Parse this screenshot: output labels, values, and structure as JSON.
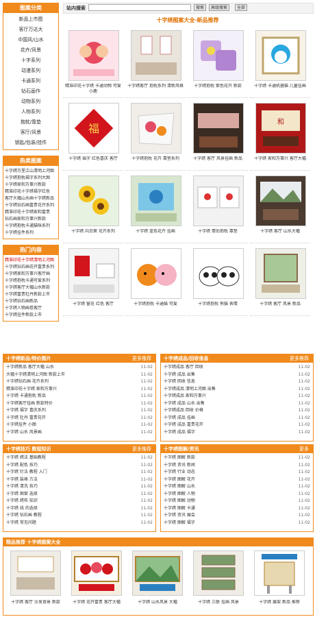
{
  "search": {
    "label": "站内搜索",
    "placeholder": "",
    "btn_search": "搜索",
    "btn_adv": "高级搜索",
    "btn_reset": "全部"
  },
  "sidebar": {
    "categories_title": "图案分类",
    "categories": [
      "新品上市图",
      "客厅万达大",
      "中国风/山水",
      "花卉/风景",
      "十字系列",
      "动漫系列",
      "卡通系列",
      "钻石画作",
      "动物系列",
      "人物系列",
      "抱枕/靠垫",
      "客厅/风景",
      "钥匙/包装/挂件"
    ],
    "hot_title": "热卖图案",
    "hot": [
      "十字绣万里江山清明上河图",
      "十字绣抱枕福字系列大图",
      "十字绣家和万事兴新款",
      "精准印花十字绣福字红色",
      "客厅大幅山水画十字绣新品",
      "十字绣钻石画富贵花开系列",
      "精准印花十字绣家和富贵",
      "钻石画家和万事兴新款",
      "十字绣抱枕卡通猫咪系列",
      "十字绣挂件系列"
    ],
    "latest_title": "热门内容",
    "latest": [
      "精准印花十字绣清明上河图",
      "十字绣钻石画花开富贵系列",
      "十字绣家和万事兴客厅画",
      "十字绣抱枕卡通可爱系列",
      "十字绣客厅大幅山水新款",
      "十字绣富贵牡丹新款上市",
      "十字绣钻石画新品",
      "十字绣人物画卷客厅",
      "十字绣挂件新款上市"
    ]
  },
  "main": {
    "title": "十字绣图案大全·新品推荐",
    "items": [
      {
        "caption": "精准印花十字绣 卡通动物 可爱小鹿",
        "icon": "deer"
      },
      {
        "caption": "十字绣客厅 抱枕系列 清新风格",
        "icon": "room"
      },
      {
        "caption": "十字绣抱枕 紫色花卉 新款",
        "icon": "pillow"
      },
      {
        "caption": "十字绣 卡通机器猫 儿童挂画",
        "icon": "cartoon"
      },
      {
        "caption": "十字绣 福字 红色喜庆 客厅",
        "icon": "fu"
      },
      {
        "caption": "十字绣抱枕 花卉 靠垫系列",
        "icon": "pillow2"
      },
      {
        "caption": "十字绣 客厅 风景挂画 新品",
        "icon": "landscape"
      },
      {
        "caption": "十字绣 家和万事兴 客厅大幅",
        "icon": "bigframe"
      },
      {
        "caption": "十字绣 向日葵 花卉系列",
        "icon": "sunflower"
      },
      {
        "caption": "十字绣 蓝色花卉 挂画",
        "icon": "blueflower"
      },
      {
        "caption": "十字绣 情侣抱枕 靠垫",
        "icon": "couple"
      },
      {
        "caption": "十字绣 客厅 山水大幅",
        "icon": "mountain"
      },
      {
        "caption": "十字绣 窗花 红色 客厅",
        "icon": "redwindow"
      },
      {
        "caption": "十字绣抱枕 卡通猫 可爱",
        "icon": "cat"
      },
      {
        "caption": "十字绣抱枕 熊猫 表情",
        "icon": "panda"
      },
      {
        "caption": "十字绣 客厅 风景 新品",
        "icon": "scenery"
      }
    ]
  },
  "panels": [
    {
      "title": "十字绣新品/特价图片",
      "more": "更多推荐",
      "rows": [
        [
          "十字绣新品 客厅大幅 山水",
          "11-02"
        ],
        [
          "大幅十字绣清明上河图 新款上市",
          "11-02"
        ],
        [
          "十字绣钻石画 花卉系列",
          "11-02"
        ],
        [
          "精准印花十字绣 家和万事兴",
          "11-02"
        ],
        [
          "十字绣 卡通抱枕 新品",
          "11-02"
        ],
        [
          "十字绣客厅挂画 新款特价",
          "11-02"
        ],
        [
          "十字绣 福字 喜庆系列",
          "11-02"
        ],
        [
          "十字绣 牡丹 富贵花开",
          "11-02"
        ],
        [
          "十字绣挂件 小图",
          "11-02"
        ],
        [
          "十字绣 山水 风景画",
          "11-02"
        ]
      ]
    },
    {
      "title": "十字绣成品/回收信息",
      "more": "更多推荐",
      "rows": [
        [
          "十字绣成品 客厅 回收",
          "11-02"
        ],
        [
          "十字绣 成品 出售",
          "11-02"
        ],
        [
          "十字绣 回收 信息",
          "11-02"
        ],
        [
          "十字绣成品 清明上河图 出售",
          "11-02"
        ],
        [
          "十字绣成品 家和万事兴",
          "11-02"
        ],
        [
          "十字绣 成品 山水 出售",
          "11-02"
        ],
        [
          "十字绣成品 回收 价格",
          "11-02"
        ],
        [
          "十字绣 成品 挂画",
          "11-02"
        ],
        [
          "十字绣 成品 富贵花开",
          "11-02"
        ],
        [
          "十字绣 成品 福字",
          "11-02"
        ]
      ]
    },
    {
      "title": "十字绣技巧 教程知识",
      "more": "更多推荐",
      "rows": [
        [
          "十字绣 绣法 基础教程",
          "11-02"
        ],
        [
          "十字绣 配色 技巧",
          "11-02"
        ],
        [
          "十字绣 针法 教程 入门",
          "11-02"
        ],
        [
          "十字绣 装裱 方法",
          "11-02"
        ],
        [
          "十字绣 清洗 技巧",
          "11-02"
        ],
        [
          "十字绣 图案 选择",
          "11-02"
        ],
        [
          "十字绣 绣布 知识",
          "11-02"
        ],
        [
          "十字绣 线 的选择",
          "11-02"
        ],
        [
          "十字绣 钻石画 教程",
          "11-02"
        ],
        [
          "十字绣 常见问题",
          "11-02"
        ]
      ]
    },
    {
      "title": "十字绣图解/资讯",
      "more": "更多",
      "rows": [
        [
          "十字绣 图解 新款",
          "11-02"
        ],
        [
          "十字绣 资讯 新闻",
          "11-02"
        ],
        [
          "十字绣 行业 动态",
          "11-02"
        ],
        [
          "十字绣 图解 花卉",
          "11-02"
        ],
        [
          "十字绣 图解 山水",
          "11-02"
        ],
        [
          "十字绣 图解 人物",
          "11-02"
        ],
        [
          "十字绣 图解 动物",
          "11-02"
        ],
        [
          "十字绣 图解 卡通",
          "11-02"
        ],
        [
          "十字绣 资讯 展会",
          "11-02"
        ],
        [
          "十字绣 图解 福字",
          "11-02"
        ]
      ]
    }
  ],
  "bottom": {
    "title": "精品推荐 十字绣图案大全",
    "items": [
      {
        "caption": "十字绣 客厅 沙发背景 新款",
        "icon": "sofa"
      },
      {
        "caption": "十字绣 花开富贵 客厅大幅",
        "icon": "flowers"
      },
      {
        "caption": "十字绣 山水风景 大幅",
        "icon": "landscape2"
      },
      {
        "caption": "十字绣 三联 挂画 风景",
        "icon": "triptych"
      },
      {
        "caption": "十字绣 展架 新品 推荐",
        "icon": "stand"
      }
    ]
  },
  "colors": {
    "accent": "#f08a1c",
    "title": "#e07000",
    "hot": "#d40000"
  }
}
